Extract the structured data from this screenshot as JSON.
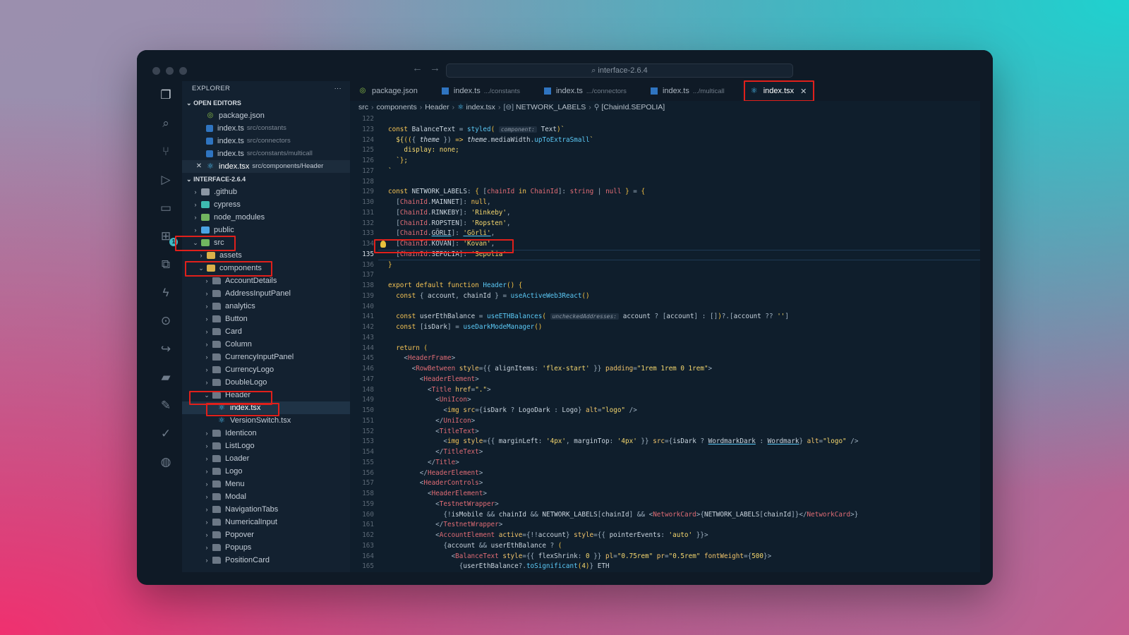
{
  "window": {
    "search_label": "⌕ interface-2.6.4",
    "nav_back": "←",
    "nav_forward": "→"
  },
  "activity_bar": {
    "icons": [
      "explorer-icon",
      "search-icon",
      "source-control-icon",
      "run-debug-icon",
      "remote-explorer-icon",
      "extensions-icon",
      "testing-icon",
      "lightning-icon",
      "git-graph-icon",
      "share-icon",
      "docker-icon",
      "pen-icon",
      "check-badge-icon",
      "octicon-icon"
    ],
    "extensions_badge": "1"
  },
  "sidebar": {
    "title": "EXPLORER",
    "more": "···",
    "open_editors_label": "OPEN EDITORS",
    "open_editors": [
      {
        "name": "package.json",
        "path": "",
        "icon": "npm"
      },
      {
        "name": "index.ts",
        "path": "src/constants",
        "icon": "ts"
      },
      {
        "name": "index.ts",
        "path": "src/connectors",
        "icon": "ts"
      },
      {
        "name": "index.ts",
        "path": "src/constants/multicall",
        "icon": "ts"
      },
      {
        "name": "index.tsx",
        "path": "src/components/Header",
        "icon": "react"
      }
    ],
    "close_mark": "✕",
    "project_label": "INTERFACE-2.6.4",
    "tree_top": [
      ".github",
      "cypress",
      "node_modules",
      "public"
    ],
    "src_label": "src",
    "assets_label": "assets",
    "components_label": "components",
    "components": [
      "AccountDetails",
      "AddressInputPanel",
      "analytics",
      "Button",
      "Card",
      "Column",
      "CurrencyInputPanel",
      "CurrencyLogo",
      "DoubleLogo"
    ],
    "header_label": "Header",
    "header_files": [
      "index.tsx",
      "VersionSwitch.tsx"
    ],
    "components_after": [
      "Identicon",
      "ListLogo",
      "Loader",
      "Logo",
      "Menu",
      "Modal",
      "NavigationTabs",
      "NumericalInput",
      "Popover",
      "Popups",
      "PositionCard"
    ]
  },
  "tabs": [
    {
      "name": "package.json",
      "desc": "",
      "icon": "npm"
    },
    {
      "name": "index.ts",
      "desc": ".../constants",
      "icon": "ts"
    },
    {
      "name": "index.ts",
      "desc": ".../connectors",
      "icon": "ts"
    },
    {
      "name": "index.ts",
      "desc": ".../multicall",
      "icon": "ts"
    },
    {
      "name": "index.tsx",
      "desc": "",
      "icon": "react",
      "active": true
    }
  ],
  "tab_close": "✕",
  "breadcrumb": [
    "src",
    "components",
    "Header",
    "index.tsx",
    "NETWORK_LABELS",
    "[ChainId.SEPOLIA]"
  ],
  "editor": {
    "line_numbers": [
      "122",
      "123",
      "124",
      "125",
      "126",
      "127",
      "128",
      "129",
      "130",
      "131",
      "132",
      "133",
      "134",
      "135",
      "136",
      "137",
      "138",
      "139",
      "140",
      "141",
      "142",
      "143",
      "144",
      "145",
      "146",
      "147",
      "148",
      "149",
      "150",
      "151",
      "152",
      "153",
      "154",
      "155",
      "156",
      "157",
      "158",
      "159",
      "160",
      "161",
      "162",
      "163",
      "164",
      "165"
    ],
    "current_line": "135"
  }
}
